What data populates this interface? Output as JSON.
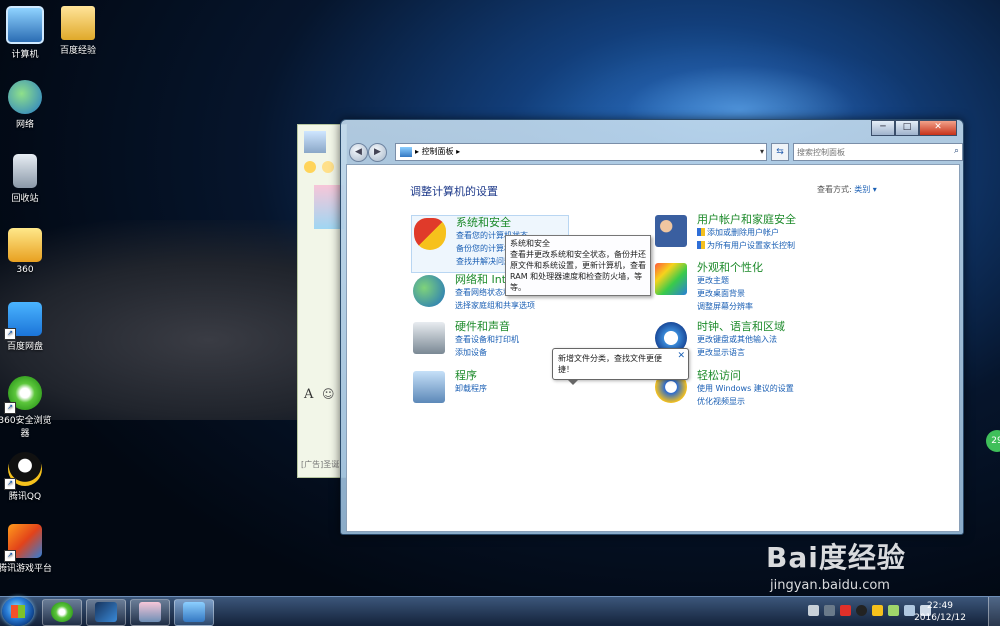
{
  "desktop": {
    "icons": [
      {
        "label": "计算机"
      },
      {
        "label": "百度经验"
      },
      {
        "label": "网络"
      },
      {
        "label": "回收站"
      },
      {
        "label": "360"
      },
      {
        "label": "百度网盘"
      },
      {
        "label": "360安全浏览器"
      },
      {
        "label": "腾讯QQ"
      },
      {
        "label": "腾讯游戏平台"
      }
    ]
  },
  "chat": {
    "ad_text": "[广告]圣诞"
  },
  "window": {
    "caption": {
      "minimize": "─",
      "maximize": "□",
      "close": "✕"
    },
    "address": "控制面板",
    "address_sep": "▸",
    "search_placeholder": "搜索控制面板",
    "title": "调整计算机的设置",
    "view_by_label": "查看方式:",
    "view_by_value": "类别 ▾",
    "categories": [
      {
        "title": "系统和安全",
        "links": [
          "查看您的计算机状态",
          "备份您的计算机",
          "查找并解决问题"
        ]
      },
      {
        "title": "网络和 Internet",
        "links": [
          "查看网络状态和任务",
          "选择家庭组和共享选项"
        ]
      },
      {
        "title": "硬件和声音",
        "links": [
          "查看设备和打印机",
          "添加设备"
        ]
      },
      {
        "title": "程序",
        "links": [
          "卸载程序"
        ]
      },
      {
        "title": "用户帐户和家庭安全",
        "links": [
          "添加或删除用户帐户",
          "为所有用户设置家长控制"
        ]
      },
      {
        "title": "外观和个性化",
        "links": [
          "更改主题",
          "更改桌面背景",
          "调整屏幕分辨率"
        ]
      },
      {
        "title": "时钟、语言和区域",
        "links": [
          "更改键盘或其他输入法",
          "更改显示语言"
        ]
      },
      {
        "title": "轻松访问",
        "links": [
          "使用 Windows 建议的设置",
          "优化视频显示"
        ]
      }
    ],
    "tooltip": {
      "title": "系统和安全",
      "body": "查看并更改系统和安全状态，备份并还原文件和系统设置，更新计算机，查看 RAM 和处理器速度和检查防火墙，等等。"
    },
    "balloon": {
      "text": "新增文件分类，查找文件更便捷！",
      "close": "✕"
    }
  },
  "side_badge": "29",
  "watermark": {
    "logo": "Bai度经验",
    "sub": "jingyan.baidu.com"
  },
  "taskbar": {
    "time": "22:49",
    "date": "2016/12/12"
  },
  "colors": {
    "link": "#1a5fb4",
    "category_title": "#1c8a2a",
    "heading": "#1e3a8a"
  }
}
